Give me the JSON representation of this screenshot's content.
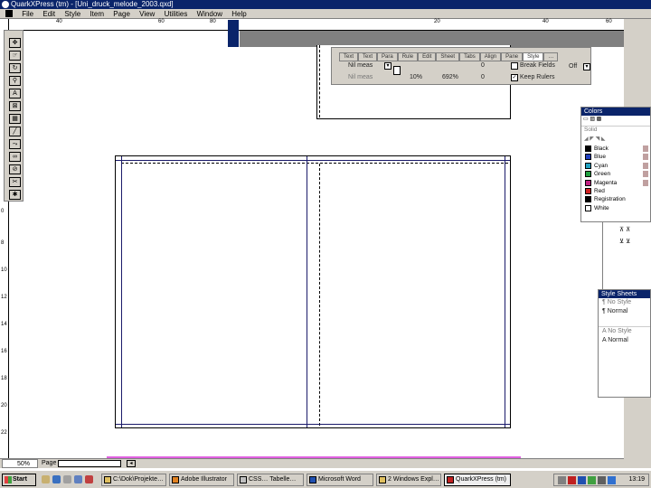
{
  "window": {
    "title": "QuarkXPress (tm) - [Uni_druck_melode_2003.qxd]"
  },
  "menu": {
    "items": [
      "File",
      "Edit",
      "Style",
      "Item",
      "Page",
      "View",
      "Utilities",
      "Window",
      "Help"
    ]
  },
  "ruler": {
    "top_labels": [
      "40",
      "60",
      "80",
      "20",
      "40",
      "60"
    ],
    "left_labels": [
      "0",
      "8",
      "10",
      "12",
      "14",
      "16",
      "18",
      "20",
      "22"
    ]
  },
  "measurements": {
    "tabs": [
      "Text",
      "Text",
      "Para",
      "Rule",
      "Edit",
      "Sheet",
      "Tabs",
      "Align",
      "Pane",
      "Style",
      "…"
    ],
    "row1": {
      "field1": "Nil meas",
      "field2": "0",
      "field3": "Break Fields",
      "field4": "Off"
    },
    "row2": {
      "field1": "Nil meas",
      "field2": "10%",
      "field3": "692%",
      "field4": "0",
      "field5": "Keep Rulers"
    }
  },
  "colors_palette": {
    "title": "Colors",
    "mode": "Solid",
    "items": [
      {
        "name": "Black",
        "color": "#000000"
      },
      {
        "name": "Blue",
        "color": "#2040c0"
      },
      {
        "name": "Cyan",
        "color": "#20a0c0"
      },
      {
        "name": "Green",
        "color": "#20a040"
      },
      {
        "name": "Magenta",
        "color": "#c02080"
      },
      {
        "name": "Red",
        "color": "#d02020"
      },
      {
        "name": "Registration",
        "color": "#000000"
      },
      {
        "name": "White",
        "color": "#ffffff"
      }
    ]
  },
  "style_sheets": {
    "title": "Style Sheets",
    "paragraph": [
      "¶ No Style",
      "¶ Normal"
    ],
    "character": [
      "A No Style",
      "A Normal"
    ]
  },
  "status": {
    "zoom": "50%",
    "page_label": "Page"
  },
  "taskbar": {
    "start": "Start",
    "tasks": [
      {
        "label": "C:\\Dok\\Projekte…"
      },
      {
        "label": "Adobe Illustrator"
      },
      {
        "label": "CSS… Tabelle…"
      },
      {
        "label": "Microsoft Word"
      },
      {
        "label": "2 Windows Expl…"
      },
      {
        "label": "QuarkXPress (tm)"
      }
    ],
    "clock": "13:19"
  }
}
